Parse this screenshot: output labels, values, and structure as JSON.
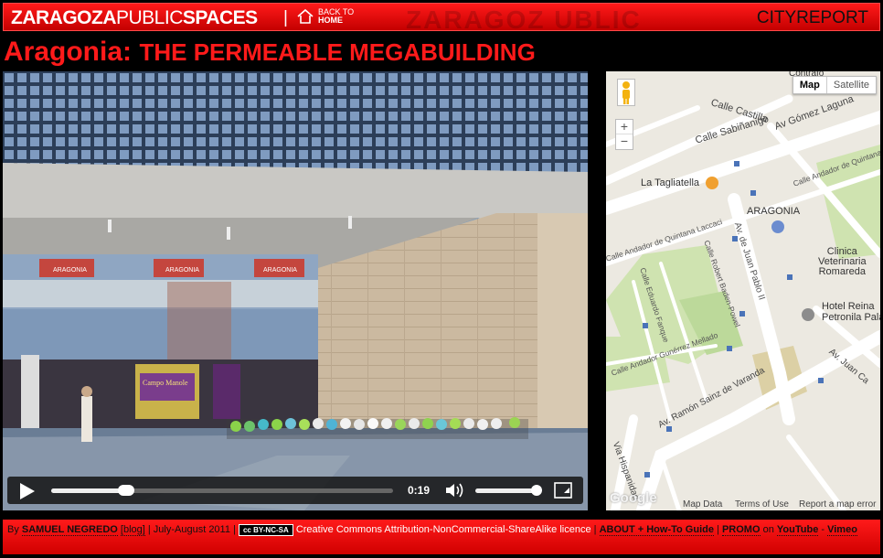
{
  "header": {
    "brand_bold": "ZARAGOZA",
    "brand_thin": "PUBLIC",
    "brand_bold2": "SPACES",
    "separator": "|",
    "back_line1": "BACK TO",
    "back_line2": "HOME",
    "ghost_text": "ZARAGOZ   UBLIC",
    "cityreport_a": "CITY",
    "cityreport_b": "REPORT"
  },
  "title": {
    "place": "Aragonia:",
    "subtitle": "THE PERMEABLE MEGABUILDING"
  },
  "video": {
    "time": "0:19",
    "progress": 0.22,
    "volume": 0.95,
    "sign1": "ARAGONIA",
    "sign2": "ARAGONIA",
    "sign3": "ARAGONIA",
    "shop_sign": "Campo Manole"
  },
  "map": {
    "toggle_map": "Map",
    "toggle_satellite": "Satellite",
    "zoom_in": "+",
    "zoom_out": "−",
    "labels": {
      "tagliatella": "La Tagliatella",
      "aragonia": "ARAGONIA",
      "clinica1": "Clinica",
      "clinica2": "Veterinaria",
      "clinica3": "Romareda",
      "hotel1": "Hotel Reina",
      "hotel2": "Petronila Pala",
      "contrafolo": "Contrafo"
    },
    "streets": {
      "castilla": "Calle Castilla",
      "sabinanigo": "Calle Sabiñanigo",
      "gomez_laguna": "Av Gómez Laguna",
      "quintana": "Calle Andador de Quintana",
      "quintana_laccaci": "Calle Andador de Quintana Laccaci",
      "juan_pablo": "Av. de Juan Pablo II",
      "baden_powel": "Calle Robert Baden-Powel",
      "eduardo_fanque": "Calle Eduardo Fanque",
      "gunerrez": "Calle Andador Gunérrez Mellado",
      "sainz_varanda": "Av. Ramón Sainz de Varanda",
      "via_hispanidad": "Via Hispanidad",
      "av_juan_ca": "Av. Juan Ca"
    },
    "footer_data": "Map Data",
    "footer_terms": "Terms of Use",
    "footer_report": "Report a map error",
    "google": "Google"
  },
  "footer": {
    "by": "By",
    "author": "SAMUEL NEGREDO",
    "blog": "[blog]",
    "date": "| July-August 2011 |",
    "cc_badge": "cc BY-NC-SA",
    "license": "Creative Commons Attribution-NonCommercial-ShareAlike licence",
    "pipe1": "|",
    "about": "ABOUT + How-To Guide",
    "pipe2": "|",
    "promo": "PROMO",
    "on": "on",
    "youtube": "YouTube",
    "dash": "-",
    "vimeo": "Vimeo"
  }
}
